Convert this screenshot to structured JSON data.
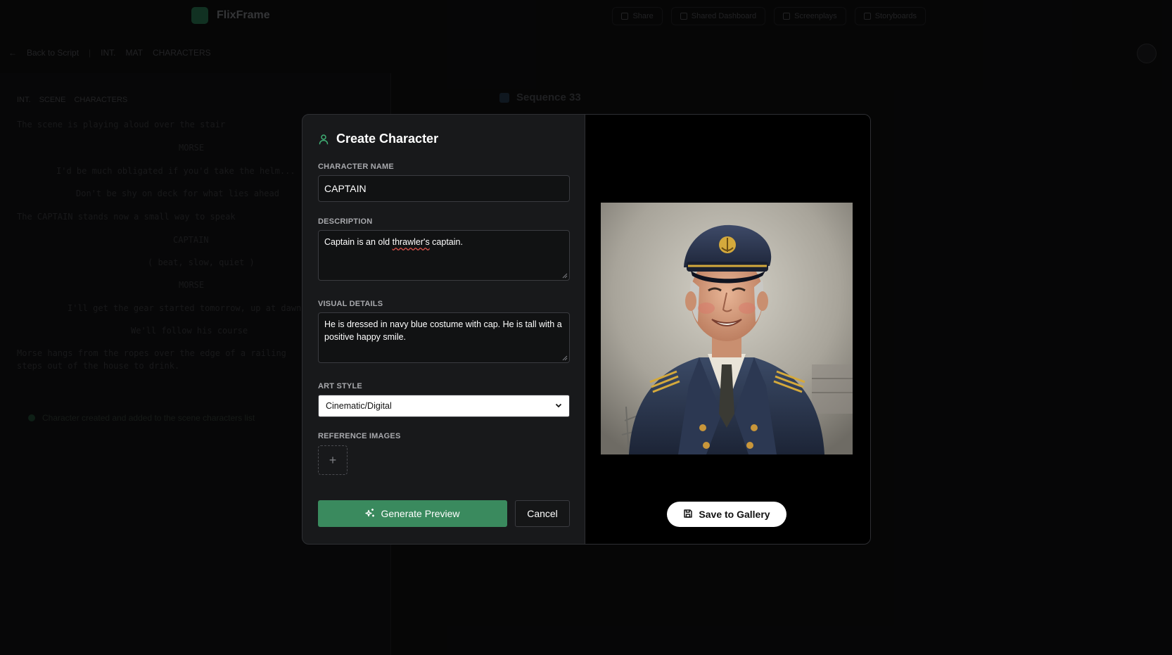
{
  "app": {
    "name": "FlixFrame",
    "nav": [
      "Share",
      "Shared Dashboard",
      "Screenplays",
      "Storyboards"
    ],
    "subbar": [
      "Back to Script",
      "INT.",
      "MAT",
      "CHARACTERS"
    ],
    "sequence_title": "Sequence 33",
    "scene_tags": [
      "INT.",
      "SCENE",
      "CHARACTERS"
    ],
    "script_lines": [
      "The scene is playing aloud over the stair",
      "MORSE",
      "I'd be much obligated if you'd take the helm...",
      "Don't be shy on deck for what lies ahead",
      "The CAPTAIN stands now a small way to speak",
      "CAPTAIN",
      "( beat, slow, quiet )",
      "MORSE",
      "I'll get the gear started tomorrow, up at dawn.",
      "We'll follow his course",
      "Morse hangs from the ropes over the edge of a railing",
      "steps out of the house to drink."
    ],
    "status_text": "Character created and added to the scene characters list"
  },
  "modal": {
    "title": "Create Character",
    "name_label": "CHARACTER NAME",
    "name_value": "CAPTAIN",
    "description_label": "DESCRIPTION",
    "description_before": "Captain is an old ",
    "description_misspelled": "thrawler's",
    "description_after": " captain.",
    "visual_label": "VISUAL DETAILS",
    "visual_value": "He is dressed in navy blue costume with cap. He is tall with a positive happy smile.",
    "art_style_label": "ART STYLE",
    "art_style_value": "Cinematic/Digital",
    "reference_label": "REFERENCE IMAGES",
    "add_symbol": "+",
    "generate_label": "Generate Preview",
    "cancel_label": "Cancel",
    "save_label": "Save to Gallery"
  },
  "colors": {
    "accent_green": "#3a8a5e",
    "modal_bg": "#18191b",
    "preview_bg": "#000000"
  },
  "icons": [
    "user-icon",
    "sparkles-icon",
    "chevron-down-icon",
    "save-icon",
    "plus-icon"
  ]
}
